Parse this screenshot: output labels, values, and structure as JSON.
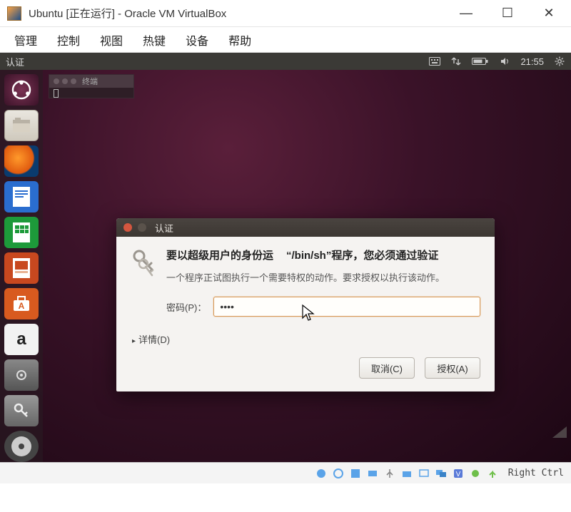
{
  "vb": {
    "title": "Ubuntu [正在运行] - Oracle VM VirtualBox",
    "winbuttons": {
      "min": "—",
      "max": "☐",
      "close": "✕"
    },
    "menu": [
      "管理",
      "控制",
      "视图",
      "热键",
      "设备",
      "帮助"
    ],
    "status": {
      "icons": [
        "disk",
        "net",
        "usb",
        "shared",
        "clipboard",
        "display",
        "vrde",
        "record",
        "capture",
        "fullscreen",
        "dock",
        "power"
      ],
      "hostkey": "Right Ctrl"
    }
  },
  "ubuntu": {
    "topbar": {
      "left": "认证",
      "time": "21:55",
      "icons": [
        "keyboard",
        "network",
        "battery",
        "sound",
        "gear"
      ]
    },
    "launcher": [
      {
        "name": "dash",
        "cls": "li-dash"
      },
      {
        "name": "files",
        "cls": "li-files"
      },
      {
        "name": "firefox",
        "cls": "li-firefox"
      },
      {
        "name": "libreoffice-writer",
        "cls": "li-writer"
      },
      {
        "name": "libreoffice-calc",
        "cls": "li-calc"
      },
      {
        "name": "libreoffice-impress",
        "cls": "li-impress"
      },
      {
        "name": "ubuntu-software",
        "cls": "li-software"
      },
      {
        "name": "amazon",
        "cls": "li-amazon"
      },
      {
        "name": "system-settings",
        "cls": "li-setting"
      },
      {
        "name": "seahorse",
        "cls": "li-key"
      },
      {
        "name": "disc",
        "cls": "li-disc"
      }
    ],
    "terminal": {
      "title": "终端"
    }
  },
  "dialog": {
    "title": "认证",
    "heading_pre": "要以超级用户的身份运",
    "heading_post": "“/bin/sh”程序，您必须通过验证",
    "subtitle": "一个程序正试图执行一个需要特权的动作。要求授权以执行该动作。",
    "password_label": "密码(P)：",
    "password_value": "••••",
    "details": "详情(D)",
    "cancel": "取消(C)",
    "authorize": "授权(A)"
  }
}
